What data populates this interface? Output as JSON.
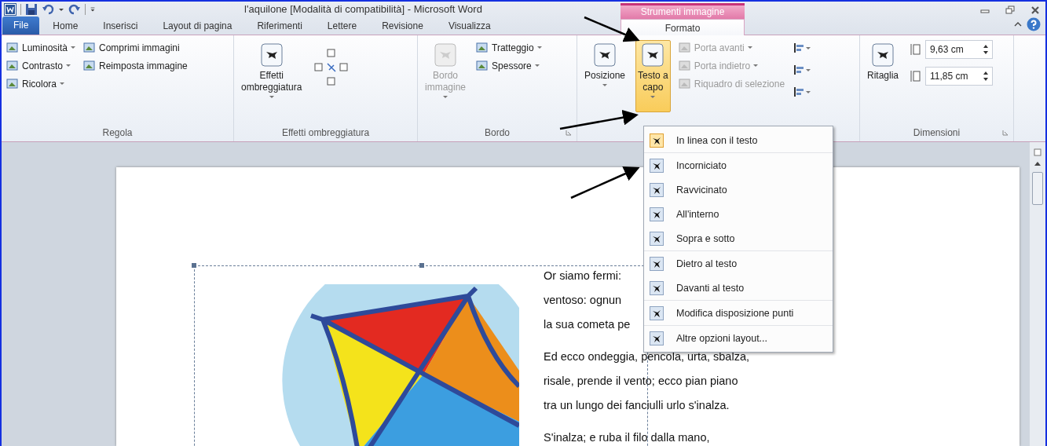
{
  "window": {
    "title": "l'aquilone [Modalità di compatibilità]  -  Microsoft Word"
  },
  "contextual_group": {
    "label": "Strumenti immagine"
  },
  "tabs": [
    {
      "label": "File",
      "kind": "file",
      "selected": false
    },
    {
      "label": "Home",
      "kind": "normal",
      "selected": false
    },
    {
      "label": "Inserisci",
      "kind": "normal",
      "selected": false
    },
    {
      "label": "Layout di pagina",
      "kind": "normal",
      "selected": false
    },
    {
      "label": "Riferimenti",
      "kind": "normal",
      "selected": false
    },
    {
      "label": "Lettere",
      "kind": "normal",
      "selected": false
    },
    {
      "label": "Revisione",
      "kind": "normal",
      "selected": false
    },
    {
      "label": "Visualizza",
      "kind": "normal",
      "selected": false
    },
    {
      "label": "Formato",
      "kind": "contextual",
      "selected": true
    }
  ],
  "ribbon_groups": [
    {
      "label": "Regola",
      "columns": [
        [
          {
            "kind": "small",
            "label": "Luminosità",
            "dropdown": true,
            "disabled": false
          },
          {
            "kind": "small",
            "label": "Contrasto",
            "dropdown": true,
            "disabled": false
          },
          {
            "kind": "small",
            "label": "Ricolora",
            "dropdown": true,
            "disabled": false
          }
        ],
        [
          {
            "kind": "small",
            "label": "Comprimi immagini",
            "dropdown": false,
            "disabled": false
          },
          {
            "kind": "small",
            "label": "Reimposta immagine",
            "dropdown": false,
            "disabled": false
          }
        ]
      ]
    },
    {
      "label": "Effetti ombreggiatura",
      "columns": [
        [
          {
            "kind": "large",
            "lines": [
              "Effetti",
              "ombreggiatura"
            ],
            "dropdown": true,
            "disabled": false,
            "pressed": false
          }
        ],
        [
          {
            "kind": "nudge"
          }
        ]
      ]
    },
    {
      "label": "Bordo",
      "launcher": true,
      "columns": [
        [
          {
            "kind": "large",
            "lines": [
              "Bordo",
              "immagine"
            ],
            "dropdown": true,
            "disabled": true,
            "pressed": false
          }
        ],
        [
          {
            "kind": "small",
            "label": "Tratteggio",
            "dropdown": true,
            "disabled": false
          },
          {
            "kind": "small",
            "label": "Spessore",
            "dropdown": true,
            "disabled": false
          }
        ]
      ]
    },
    {
      "columns": [
        [
          {
            "kind": "large",
            "lines": [
              "Posizione"
            ],
            "dropdown": true,
            "disabled": false,
            "pressed": false
          }
        ],
        [
          {
            "kind": "large",
            "lines": [
              "Testo a",
              "capo"
            ],
            "dropdown": true,
            "disabled": false,
            "pressed": true
          }
        ],
        [
          {
            "kind": "small",
            "label": "Porta avanti",
            "dropdown": true,
            "disabled": true
          },
          {
            "kind": "small",
            "label": "Porta indietro",
            "dropdown": true,
            "disabled": true
          },
          {
            "kind": "small",
            "label": "Riquadro di selezione",
            "dropdown": false,
            "disabled": true
          }
        ],
        [
          {
            "kind": "iconsmall"
          },
          {
            "kind": "iconsmall"
          },
          {
            "kind": "iconsmall"
          }
        ]
      ]
    },
    {
      "label": "Dimensioni",
      "launcher": true,
      "columns": [
        [
          {
            "kind": "large",
            "lines": [
              "Ritaglia"
            ],
            "dropdown": false,
            "disabled": false,
            "pressed": false
          }
        ],
        [
          {
            "kind": "spin",
            "value": "9,63 cm"
          },
          {
            "kind": "spin",
            "value": "11,85 cm"
          }
        ]
      ]
    }
  ],
  "wrap_menu": {
    "sections": [
      [
        {
          "label": "In linea con il testo",
          "selected": true
        }
      ],
      [
        {
          "label": "Incorniciato",
          "selected": false
        },
        {
          "label": "Ravvicinato",
          "selected": false
        },
        {
          "label": "All'interno",
          "selected": false
        },
        {
          "label": "Sopra e sotto",
          "selected": false
        }
      ],
      [
        {
          "label": "Dietro al testo",
          "selected": false
        },
        {
          "label": "Davanti al testo",
          "selected": false
        }
      ],
      [
        {
          "label": "Modifica disposizione punti",
          "selected": false
        }
      ],
      [
        {
          "label": "Altre opzioni layout...",
          "selected": false
        }
      ]
    ]
  },
  "document": {
    "paragraphs": [
      [
        "Or siamo fermi:",
        "ventoso: ognun",
        "la sua cometa pe"
      ],
      [
        "Ed ecco ondeggia, pencola, urta, sbalza,",
        "risale, prende il vento; ecco pian piano",
        "tra un lungo dei fanciulli urlo s'inalza."
      ],
      [
        "S'inalza; e ruba il filo dalla mano,"
      ]
    ]
  }
}
